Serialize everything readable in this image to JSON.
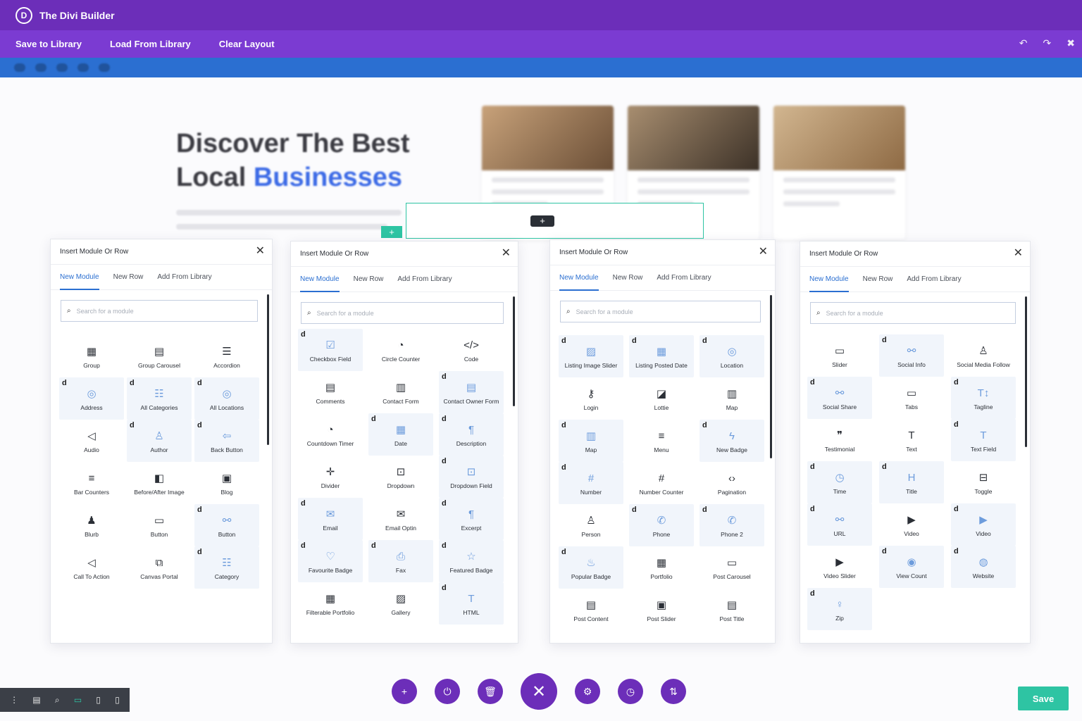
{
  "app": {
    "title": "The Divi Builder",
    "logo_letter": "D"
  },
  "menu": {
    "items": [
      "Save to Library",
      "Load From Library",
      "Clear Layout"
    ],
    "undo_icon": "↶",
    "redo_icon": "↷",
    "close_icon": "✖"
  },
  "hero": {
    "line1": "Discover The Best",
    "line2_a": "Local ",
    "line2_b": "Businesses"
  },
  "dialog_title": "Insert Module Or Row",
  "tabs": [
    "New Module",
    "New Row",
    "Add From Library"
  ],
  "search_placeholder": "Search for a module",
  "dialogs": [
    {
      "modules": [
        {
          "label": "Group",
          "icon": "▦",
          "hl": false,
          "d": false
        },
        {
          "label": "Group Carousel",
          "icon": "▤",
          "hl": false,
          "d": false
        },
        {
          "label": "Accordion",
          "icon": "☰",
          "hl": false,
          "d": false
        },
        {
          "label": "Address",
          "icon": "◎",
          "hl": true,
          "d": true
        },
        {
          "label": "All Categories",
          "icon": "☷",
          "hl": true,
          "d": true
        },
        {
          "label": "All Locations",
          "icon": "◎",
          "hl": true,
          "d": true
        },
        {
          "label": "Audio",
          "icon": "◁",
          "hl": false,
          "d": false
        },
        {
          "label": "Author",
          "icon": "♙",
          "hl": true,
          "d": true
        },
        {
          "label": "Back Button",
          "icon": "⇦",
          "hl": true,
          "d": true
        },
        {
          "label": "Bar Counters",
          "icon": "≡",
          "hl": false,
          "d": false
        },
        {
          "label": "Before/After Image",
          "icon": "◧",
          "hl": false,
          "d": false
        },
        {
          "label": "Blog",
          "icon": "▣",
          "hl": false,
          "d": false
        },
        {
          "label": "Blurb",
          "icon": "♟",
          "hl": false,
          "d": false
        },
        {
          "label": "Button",
          "icon": "▭",
          "hl": false,
          "d": false
        },
        {
          "label": "Button",
          "icon": "⚯",
          "hl": true,
          "d": true
        },
        {
          "label": "Call To Action",
          "icon": "◁",
          "hl": false,
          "d": false
        },
        {
          "label": "Canvas Portal",
          "icon": "⧉",
          "hl": false,
          "d": false
        },
        {
          "label": "Category",
          "icon": "☷",
          "hl": true,
          "d": true
        }
      ]
    },
    {
      "modules": [
        {
          "label": "Checkbox Field",
          "icon": "☑",
          "hl": true,
          "d": true
        },
        {
          "label": "Circle Counter",
          "icon": "◔",
          "hl": false,
          "d": false
        },
        {
          "label": "Code",
          "icon": "</>",
          "hl": false,
          "d": false
        },
        {
          "label": "Comments",
          "icon": "▤",
          "hl": false,
          "d": false
        },
        {
          "label": "Contact Form",
          "icon": "▥",
          "hl": false,
          "d": false
        },
        {
          "label": "Contact Owner Form",
          "icon": "▤",
          "hl": true,
          "d": true
        },
        {
          "label": "Countdown Timer",
          "icon": "◔",
          "hl": false,
          "d": false
        },
        {
          "label": "Date",
          "icon": "▦",
          "hl": true,
          "d": true
        },
        {
          "label": "Description",
          "icon": "¶",
          "hl": true,
          "d": true
        },
        {
          "label": "Divider",
          "icon": "✛",
          "hl": false,
          "d": false
        },
        {
          "label": "Dropdown",
          "icon": "⊡",
          "hl": false,
          "d": false
        },
        {
          "label": "Dropdown Field",
          "icon": "⊡",
          "hl": true,
          "d": true
        },
        {
          "label": "Email",
          "icon": "✉",
          "hl": true,
          "d": true
        },
        {
          "label": "Email Optin",
          "icon": "✉",
          "hl": false,
          "d": false
        },
        {
          "label": "Excerpt",
          "icon": "¶",
          "hl": true,
          "d": true
        },
        {
          "label": "Favourite Badge",
          "icon": "♡",
          "hl": true,
          "d": true
        },
        {
          "label": "Fax",
          "icon": "⎙",
          "hl": true,
          "d": true
        },
        {
          "label": "Featured Badge",
          "icon": "☆",
          "hl": true,
          "d": true
        },
        {
          "label": "Filterable Portfolio",
          "icon": "▦",
          "hl": false,
          "d": false
        },
        {
          "label": "Gallery",
          "icon": "▨",
          "hl": false,
          "d": false
        },
        {
          "label": "HTML",
          "icon": "T",
          "hl": true,
          "d": true
        }
      ]
    },
    {
      "modules": [
        {
          "label": "Listing Image Slider",
          "icon": "▨",
          "hl": true,
          "d": true
        },
        {
          "label": "Listing Posted Date",
          "icon": "▦",
          "hl": true,
          "d": true
        },
        {
          "label": "Location",
          "icon": "◎",
          "hl": true,
          "d": true
        },
        {
          "label": "Login",
          "icon": "⚷",
          "hl": false,
          "d": false
        },
        {
          "label": "Lottie",
          "icon": "◪",
          "hl": false,
          "d": false
        },
        {
          "label": "Map",
          "icon": "▥",
          "hl": false,
          "d": false
        },
        {
          "label": "Map",
          "icon": "▥",
          "hl": true,
          "d": true
        },
        {
          "label": "Menu",
          "icon": "≡",
          "hl": false,
          "d": false
        },
        {
          "label": "New Badge",
          "icon": "ϟ",
          "hl": true,
          "d": true
        },
        {
          "label": "Number",
          "icon": "#",
          "hl": true,
          "d": true
        },
        {
          "label": "Number Counter",
          "icon": "#",
          "hl": false,
          "d": false
        },
        {
          "label": "Pagination",
          "icon": "‹›",
          "hl": false,
          "d": false
        },
        {
          "label": "Person",
          "icon": "♙",
          "hl": false,
          "d": false
        },
        {
          "label": "Phone",
          "icon": "✆",
          "hl": true,
          "d": true
        },
        {
          "label": "Phone 2",
          "icon": "✆",
          "hl": true,
          "d": true
        },
        {
          "label": "Popular Badge",
          "icon": "♨",
          "hl": true,
          "d": true
        },
        {
          "label": "Portfolio",
          "icon": "▦",
          "hl": false,
          "d": false
        },
        {
          "label": "Post Carousel",
          "icon": "▭",
          "hl": false,
          "d": false
        },
        {
          "label": "Post Content",
          "icon": "▤",
          "hl": false,
          "d": false
        },
        {
          "label": "Post Slider",
          "icon": "▣",
          "hl": false,
          "d": false
        },
        {
          "label": "Post Title",
          "icon": "▤",
          "hl": false,
          "d": false
        }
      ]
    },
    {
      "modules": [
        {
          "label": "Slider",
          "icon": "▭",
          "hl": false,
          "d": false
        },
        {
          "label": "Social Info",
          "icon": "⚯",
          "hl": true,
          "d": true
        },
        {
          "label": "Social Media Follow",
          "icon": "♙",
          "hl": false,
          "d": false
        },
        {
          "label": "Social Share",
          "icon": "⚯",
          "hl": true,
          "d": true
        },
        {
          "label": "Tabs",
          "icon": "▭",
          "hl": false,
          "d": false
        },
        {
          "label": "Tagline",
          "icon": "T↕",
          "hl": true,
          "d": true
        },
        {
          "label": "Testimonial",
          "icon": "❞",
          "hl": false,
          "d": false
        },
        {
          "label": "Text",
          "icon": "T",
          "hl": false,
          "d": false
        },
        {
          "label": "Text Field",
          "icon": "T",
          "hl": true,
          "d": true
        },
        {
          "label": "Time",
          "icon": "◷",
          "hl": true,
          "d": true
        },
        {
          "label": "Title",
          "icon": "H",
          "hl": true,
          "d": true
        },
        {
          "label": "Toggle",
          "icon": "⊟",
          "hl": false,
          "d": false
        },
        {
          "label": "URL",
          "icon": "⚯",
          "hl": true,
          "d": true
        },
        {
          "label": "Video",
          "icon": "▶",
          "hl": false,
          "d": false
        },
        {
          "label": "Video",
          "icon": "▶",
          "hl": true,
          "d": true
        },
        {
          "label": "Video Slider",
          "icon": "▶",
          "hl": false,
          "d": false
        },
        {
          "label": "View Count",
          "icon": "◉",
          "hl": true,
          "d": true
        },
        {
          "label": "Website",
          "icon": "◍",
          "hl": true,
          "d": true
        },
        {
          "label": "Zip",
          "icon": "♀",
          "hl": true,
          "d": true
        }
      ]
    }
  ],
  "view_bar": [
    "⋮",
    "▤",
    "⌕",
    "▭",
    "▯",
    "▯"
  ],
  "actions": [
    {
      "icon": "+",
      "name": "add-button"
    },
    {
      "icon": "⏻",
      "name": "portability-button"
    },
    {
      "icon": "🗑",
      "name": "delete-button"
    },
    {
      "icon": "✕",
      "name": "close-builder-button"
    },
    {
      "icon": "⚙",
      "name": "settings-button"
    },
    {
      "icon": "◷",
      "name": "history-button"
    },
    {
      "icon": "⇅",
      "name": "sort-button"
    }
  ],
  "save_label": "Save"
}
